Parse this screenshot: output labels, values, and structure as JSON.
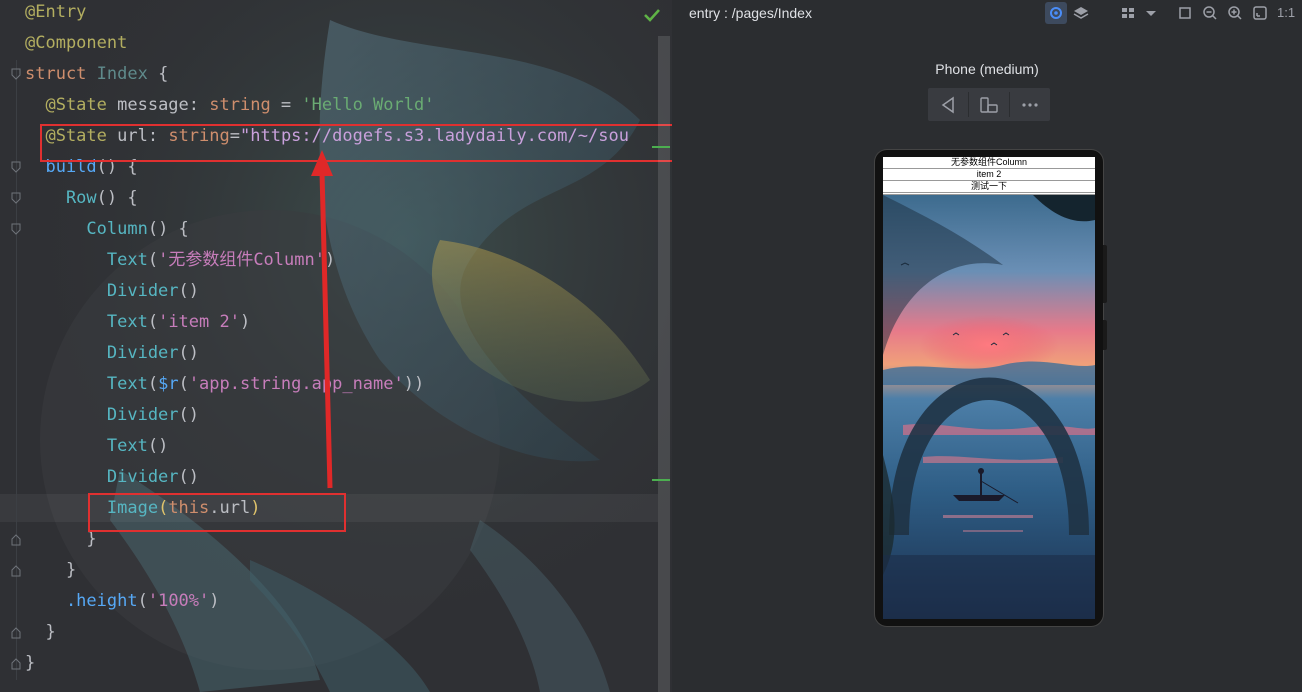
{
  "editor": {
    "lines": [
      {
        "segments": [
          {
            "t": "@Entry",
            "c": "ann"
          }
        ]
      },
      {
        "segments": [
          {
            "t": "@Component",
            "c": "ann"
          }
        ]
      },
      {
        "segments": [
          {
            "t": "struct ",
            "c": "kw"
          },
          {
            "t": "Index ",
            "c": "cls"
          },
          {
            "t": "{",
            "c": "punc"
          }
        ]
      },
      {
        "segments": [
          {
            "t": "  @State ",
            "c": "ann"
          },
          {
            "t": "message",
            "c": "plain"
          },
          {
            "t": ": ",
            "c": "punc"
          },
          {
            "t": "string",
            "c": "kw"
          },
          {
            "t": " = ",
            "c": "punc"
          },
          {
            "t": "'Hello World'",
            "c": "str"
          }
        ]
      },
      {
        "segments": [
          {
            "t": "  @State ",
            "c": "ann"
          },
          {
            "t": "url",
            "c": "plain"
          },
          {
            "t": ": ",
            "c": "punc"
          },
          {
            "t": "string",
            "c": "kw"
          },
          {
            "t": "=",
            "c": "punc"
          },
          {
            "t": "\"https://dogefs.s3.ladydaily.com/~/sou",
            "c": "url"
          }
        ]
      },
      {
        "segments": [
          {
            "t": "  build",
            "c": "fn"
          },
          {
            "t": "() {",
            "c": "punc"
          }
        ]
      },
      {
        "segments": [
          {
            "t": "    Row",
            "c": "compname"
          },
          {
            "t": "() {",
            "c": "punc"
          }
        ]
      },
      {
        "segments": [
          {
            "t": "      Column",
            "c": "compname"
          },
          {
            "t": "() {",
            "c": "punc"
          }
        ]
      },
      {
        "segments": [
          {
            "t": "        Text",
            "c": "compname"
          },
          {
            "t": "(",
            "c": "punc"
          },
          {
            "t": "'无参数组件Column'",
            "c": "tmpl"
          },
          {
            "t": ")",
            "c": "punc"
          }
        ]
      },
      {
        "segments": [
          {
            "t": "        Divider",
            "c": "compname"
          },
          {
            "t": "()",
            "c": "punc"
          }
        ]
      },
      {
        "segments": [
          {
            "t": "        Text",
            "c": "compname"
          },
          {
            "t": "(",
            "c": "punc"
          },
          {
            "t": "'item 2'",
            "c": "tmpl"
          },
          {
            "t": ")",
            "c": "punc"
          }
        ]
      },
      {
        "segments": [
          {
            "t": "        Divider",
            "c": "compname"
          },
          {
            "t": "()",
            "c": "punc"
          }
        ]
      },
      {
        "segments": [
          {
            "t": "        Text",
            "c": "compname"
          },
          {
            "t": "(",
            "c": "punc"
          },
          {
            "t": "$r",
            "c": "fn"
          },
          {
            "t": "(",
            "c": "punc"
          },
          {
            "t": "'app.string.app_name'",
            "c": "tmpl"
          },
          {
            "t": "))",
            "c": "punc"
          }
        ]
      },
      {
        "segments": [
          {
            "t": "        Divider",
            "c": "compname"
          },
          {
            "t": "()",
            "c": "punc"
          }
        ]
      },
      {
        "segments": [
          {
            "t": "        Text",
            "c": "compname"
          },
          {
            "t": "()",
            "c": "punc"
          }
        ]
      },
      {
        "segments": [
          {
            "t": "        Divider",
            "c": "compname"
          },
          {
            "t": "()",
            "c": "punc"
          }
        ]
      },
      {
        "segments": [
          {
            "t": "        Image",
            "c": "compname"
          },
          {
            "t": "(",
            "c": "paren"
          },
          {
            "t": "this",
            "c": "kw"
          },
          {
            "t": ".",
            "c": "punc"
          },
          {
            "t": "url",
            "c": "plain"
          },
          {
            "t": ")",
            "c": "paren"
          }
        ]
      },
      {
        "segments": [
          {
            "t": "      }",
            "c": "punc"
          }
        ]
      },
      {
        "segments": [
          {
            "t": "    }",
            "c": "punc"
          }
        ]
      },
      {
        "segments": [
          {
            "t": "    .height",
            "c": "fn"
          },
          {
            "t": "(",
            "c": "punc"
          },
          {
            "t": "'100%'",
            "c": "tmpl"
          },
          {
            "t": ")",
            "c": "punc"
          }
        ]
      },
      {
        "segments": [
          {
            "t": "  }",
            "c": "punc"
          }
        ]
      },
      {
        "segments": [
          {
            "t": "}",
            "c": "punc"
          }
        ]
      }
    ]
  },
  "previewer": {
    "title": "entry : /pages/Index",
    "device_name": "Phone (medium)",
    "toolbar_icons": [
      "inspector-icon",
      "layers-icon",
      "grid-icon",
      "dropdown-icon",
      "crop-icon",
      "zoom-out-icon",
      "zoom-in-icon",
      "fit-icon"
    ],
    "zoom_ratio": "1:1",
    "device_buttons": [
      "back-icon",
      "rotate-icon",
      "more-icon"
    ],
    "screen": {
      "text1": "无参数组件Column",
      "text2": "item 2",
      "text3": "测试一下"
    }
  },
  "colors": {
    "highlight_box": "#e03030",
    "arrow": "#e02828"
  }
}
